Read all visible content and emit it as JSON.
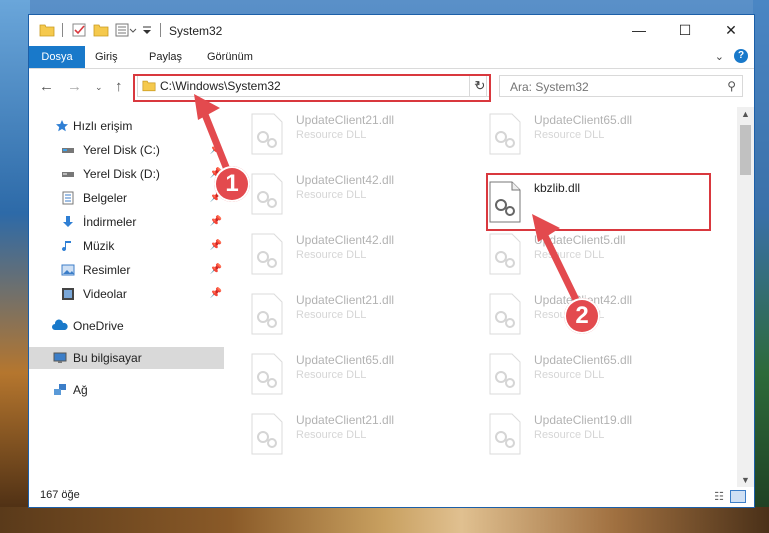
{
  "titlebar": {
    "title": "System32",
    "icons": [
      "folder-icon",
      "properties-check-icon",
      "new-folder-icon",
      "properties-icon",
      "customize-dropdown-icon"
    ],
    "buttons": {
      "minimize": "—",
      "maximize": "☐",
      "close": "✕"
    }
  },
  "ribbon": {
    "tabs": [
      "Dosya",
      "Giriş",
      "Paylaş",
      "Görünüm"
    ],
    "help": "?"
  },
  "navbar": {
    "address": "C:\\Windows\\System32",
    "search_placeholder": "Ara: System32"
  },
  "sidebar": {
    "items": [
      {
        "label": "Hızlı erişim",
        "icon": "star-icon",
        "pinned": false
      },
      {
        "label": "Yerel Disk (C:)",
        "icon": "drive-icon",
        "pinned": true
      },
      {
        "label": "Yerel Disk (D:)",
        "icon": "drive-icon",
        "pinned": true
      },
      {
        "label": "Belgeler",
        "icon": "documents-icon",
        "pinned": true
      },
      {
        "label": "İndirmeler",
        "icon": "download-icon",
        "pinned": true
      },
      {
        "label": "Müzik",
        "icon": "music-icon",
        "pinned": true
      },
      {
        "label": "Resimler",
        "icon": "pictures-icon",
        "pinned": true
      },
      {
        "label": "Videolar",
        "icon": "videos-icon",
        "pinned": true
      },
      {
        "label": "OneDrive",
        "icon": "cloud-icon",
        "pinned": false
      },
      {
        "label": "Bu bilgisayar",
        "icon": "computer-icon",
        "pinned": false,
        "selected": true
      },
      {
        "label": "Ağ",
        "icon": "network-icon",
        "pinned": false
      }
    ]
  },
  "files": [
    {
      "name": "UpdateClient21.dll",
      "type": "Resource DLL",
      "faded": true
    },
    {
      "name": "UpdateClient65.dll",
      "type": "Resource DLL",
      "faded": true
    },
    {
      "name": "UpdateClient42.dll",
      "type": "Resource DLL",
      "faded": true
    },
    {
      "name": "kbzlib.dll",
      "type": "",
      "faded": false
    },
    {
      "name": "UpdateClient42.dll",
      "type": "Resource DLL",
      "faded": true
    },
    {
      "name": "UpdateClient5.dll",
      "type": "Resource DLL",
      "faded": true
    },
    {
      "name": "UpdateClient21.dll",
      "type": "Resource DLL",
      "faded": true
    },
    {
      "name": "UpdateClient42.dll",
      "type": "Resource DLL",
      "faded": true
    },
    {
      "name": "UpdateClient65.dll",
      "type": "Resource DLL",
      "faded": true
    },
    {
      "name": "UpdateClient65.dll",
      "type": "Resource DLL",
      "faded": true
    },
    {
      "name": "UpdateClient21.dll",
      "type": "Resource DLL",
      "faded": true
    },
    {
      "name": "UpdateClient19.dll",
      "type": "Resource DLL",
      "faded": true
    }
  ],
  "status": {
    "count": "167 öğe"
  },
  "callouts": [
    "1",
    "2"
  ],
  "colors": {
    "accent": "#1979ca",
    "highlight": "#d9383e",
    "callout": "#e34a4e"
  }
}
